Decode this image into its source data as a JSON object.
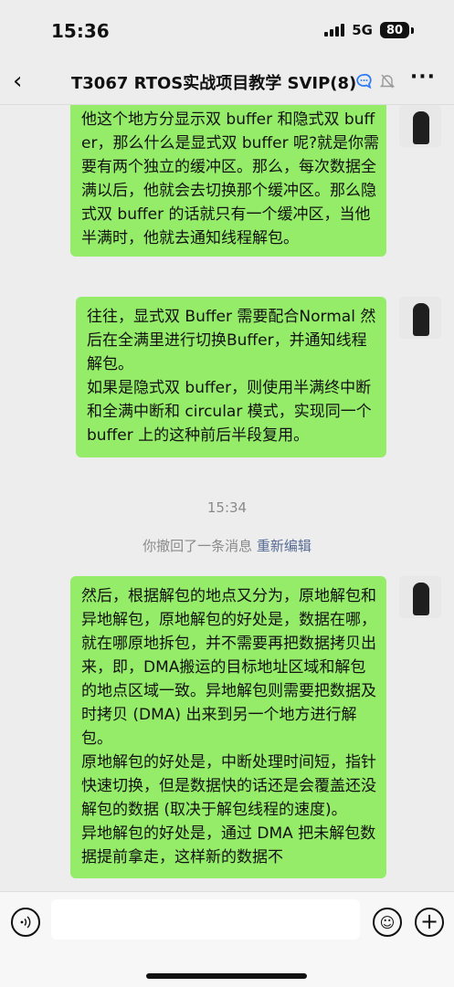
{
  "status": {
    "time": "15:36",
    "network": "5G",
    "battery": "80"
  },
  "nav": {
    "back_icon": "chevron-left-icon",
    "title": "T3067 RTOS实战项目教学 SVIP(8)",
    "more": "···"
  },
  "messages": [
    {
      "text": "他这个地方分显示双 buffer 和隐式双 buffer，那么什么是显式双 buffer 呢?就是你需要有两个独立的缓冲区。那么，每次数据全满以后，他就会去切换那个缓冲区。那么隐式双 buffer 的话就只有一个缓冲区，当他半满时，他就去通知线程解包。"
    },
    {
      "text": "往往，显式双 Buffer 需要配合Normal 然后在全满里进行切换Buffer，并通知线程解包。\n如果是隐式双 buffer，则使用半满终中断和全满中断和 circular 模式，实现同一个 buffer 上的这种前后半段复用。"
    },
    {
      "text": "然后，根据解包的地点又分为，原地解包和异地解包，原地解包的好处是，数据在哪，就在哪原地拆包，并不需要再把数据拷贝出来，即，DMA搬运的目标地址区域和解包的地点区域一致。异地解包则需要把数据及时拷贝 (DMA) 出来到另一个地方进行解包。\n原地解包的好处是，中断处理时间短，指针快速切换，但是数据快的话还是会覆盖还没解包的数据 (取决于解包线程的速度)。\n异地解包的好处是，通过 DMA 把未解包数据提前拿走，这样新的数据不"
    }
  ],
  "timestamp": "15:34",
  "recall": {
    "text": "你撤回了一条消息",
    "action": "重新编辑"
  },
  "input": {
    "voice_icon": "voice-icon",
    "emoji": "☺",
    "plus": "+"
  },
  "colors": {
    "bubble": "#95ec69",
    "background": "#ededed",
    "link": "#576b95"
  }
}
